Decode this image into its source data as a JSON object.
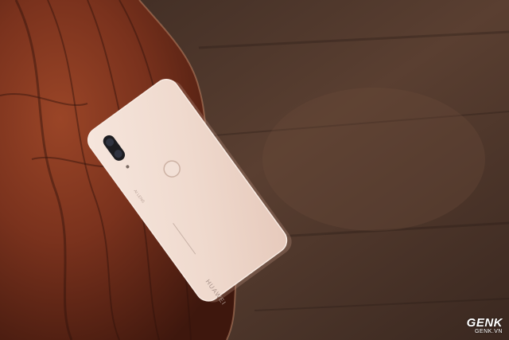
{
  "photo": {
    "subject": "phone-back-on-wood-slab",
    "phone_color": "#f3ddd2",
    "background_color": "#4a3228",
    "slab_color": "#7a3420",
    "brand_text": "HUAWEI"
  },
  "watermark": {
    "main": "GENK",
    "sub": "GENK.VN"
  }
}
